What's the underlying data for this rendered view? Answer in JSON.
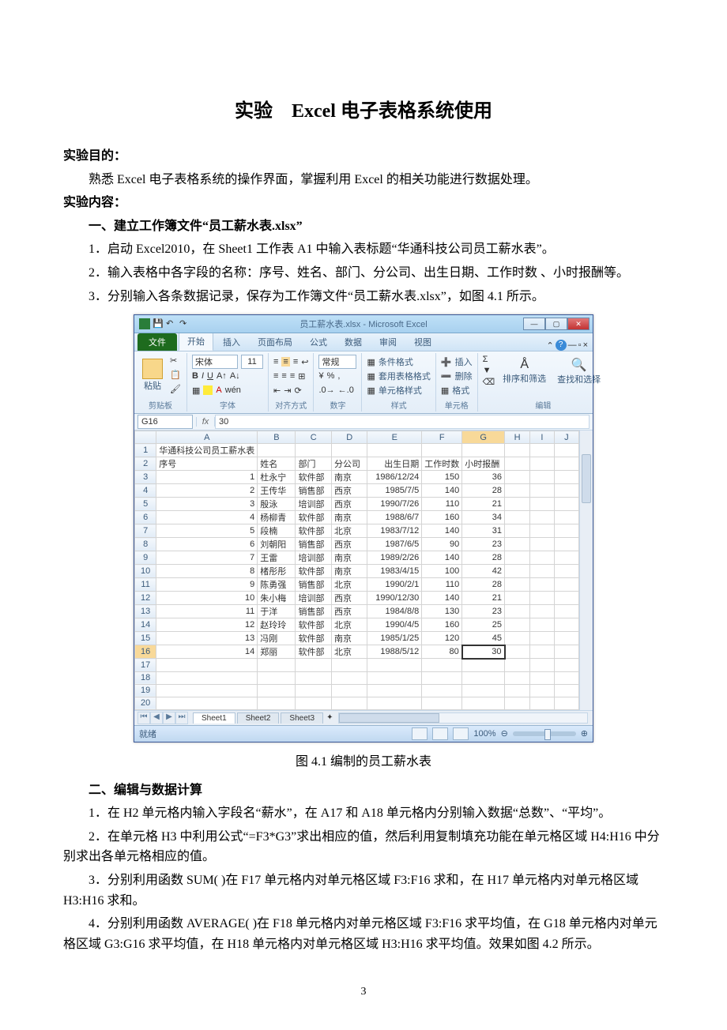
{
  "doc": {
    "title": "实验　Excel 电子表格系统使用",
    "sec_purpose_head": "实验目的：",
    "sec_purpose_body": "熟悉 Excel 电子表格系统的操作界面，掌握利用 Excel 的相关功能进行数据处理。",
    "sec_content_head": "实验内容：",
    "sec1_head": "一、建立工作簿文件“员工薪水表.xlsx”",
    "sec1_p1": "1．启动 Excel2010，在 Sheet1 工作表 A1 中输入表标题“华通科技公司员工薪水表”。",
    "sec1_p2": "2．输入表格中各字段的名称：序号、姓名、部门、分公司、出生日期、工作时数 、小时报酬等。",
    "sec1_p3": "3．分别输入各条数据记录，保存为工作簿文件“员工薪水表.xlsx”，如图 4.1 所示。",
    "fig_caption": "图 4.1  编制的员工薪水表",
    "sec2_head": "二、编辑与数据计算",
    "sec2_p1": "1．在 H2 单元格内输入字段名“薪水”，在 A17 和 A18 单元格内分别输入数据“总数”、“平均”。",
    "sec2_p2": "2．在单元格 H3 中利用公式“=F3*G3”求出相应的值，然后利用复制填充功能在单元格区域 H4:H16 中分别求出各单元格相应的值。",
    "sec2_p3": "3．分别利用函数 SUM( )在 F17 单元格内对单元格区域 F3:F16 求和，在 H17 单元格内对单元格区域 H3:H16 求和。",
    "sec2_p4": "4．分别利用函数 AVERAGE( )在 F18 单元格内对单元格区域 F3:F16 求平均值，在 G18 单元格内对单元格区域 G3:G16 求平均值，在 H18 单元格内对单元格区域 H3:H16 求平均值。效果如图 4.2 所示。",
    "pagenum": "3"
  },
  "excel": {
    "titlebar": "员工薪水表.xlsx - Microsoft Excel",
    "tabs": {
      "file": "文件",
      "home": "开始",
      "insert": "插入",
      "layout": "页面布局",
      "formula": "公式",
      "data": "数据",
      "review": "审阅",
      "view": "视图"
    },
    "groups": {
      "clipboard": "剪贴板",
      "paste": "粘贴",
      "font": "字体",
      "align": "对齐方式",
      "number": "数字",
      "styles": "样式",
      "cells": "单元格",
      "editing": "编辑"
    },
    "font": {
      "name": "宋体",
      "size": "11"
    },
    "numfmt": "常规",
    "styles": {
      "cond": "条件格式",
      "tbl": "套用表格格式",
      "cell": "单元格样式"
    },
    "cells": {
      "insert": "插入",
      "delete": "删除",
      "format": "格式"
    },
    "editing": {
      "sort": "排序和筛选",
      "find": "查找和选择"
    },
    "namebox": "G16",
    "formula": "30",
    "cols": [
      "A",
      "B",
      "C",
      "D",
      "E",
      "F",
      "G",
      "H",
      "I",
      "J"
    ],
    "row1": "华通科技公司员工薪水表",
    "headers": {
      "A": "序号",
      "B": "姓名",
      "C": "部门",
      "D": "分公司",
      "E": "出生日期",
      "F": "工作时数",
      "G": "小时报酬"
    },
    "rows": [
      {
        "n": "3",
        "A": "1",
        "B": "杜永宁",
        "C": "软件部",
        "D": "南京",
        "E": "1986/12/24",
        "F": "150",
        "G": "36"
      },
      {
        "n": "4",
        "A": "2",
        "B": "王传华",
        "C": "销售部",
        "D": "西京",
        "E": "1985/7/5",
        "F": "140",
        "G": "28"
      },
      {
        "n": "5",
        "A": "3",
        "B": "殷泳",
        "C": "培训部",
        "D": "西京",
        "E": "1990/7/26",
        "F": "110",
        "G": "21"
      },
      {
        "n": "6",
        "A": "4",
        "B": "杨柳青",
        "C": "软件部",
        "D": "南京",
        "E": "1988/6/7",
        "F": "160",
        "G": "34"
      },
      {
        "n": "7",
        "A": "5",
        "B": "段楠",
        "C": "软件部",
        "D": "北京",
        "E": "1983/7/12",
        "F": "140",
        "G": "31"
      },
      {
        "n": "8",
        "A": "6",
        "B": "刘朝阳",
        "C": "销售部",
        "D": "西京",
        "E": "1987/6/5",
        "F": "90",
        "G": "23"
      },
      {
        "n": "9",
        "A": "7",
        "B": "王雷",
        "C": "培训部",
        "D": "南京",
        "E": "1989/2/26",
        "F": "140",
        "G": "28"
      },
      {
        "n": "10",
        "A": "8",
        "B": "楮彤彤",
        "C": "软件部",
        "D": "南京",
        "E": "1983/4/15",
        "F": "100",
        "G": "42"
      },
      {
        "n": "11",
        "A": "9",
        "B": "陈勇强",
        "C": "销售部",
        "D": "北京",
        "E": "1990/2/1",
        "F": "110",
        "G": "28"
      },
      {
        "n": "12",
        "A": "10",
        "B": "朱小梅",
        "C": "培训部",
        "D": "西京",
        "E": "1990/12/30",
        "F": "140",
        "G": "21"
      },
      {
        "n": "13",
        "A": "11",
        "B": "于洋",
        "C": "销售部",
        "D": "西京",
        "E": "1984/8/8",
        "F": "130",
        "G": "23"
      },
      {
        "n": "14",
        "A": "12",
        "B": "赵玲玲",
        "C": "软件部",
        "D": "北京",
        "E": "1990/4/5",
        "F": "160",
        "G": "25"
      },
      {
        "n": "15",
        "A": "13",
        "B": "冯刚",
        "C": "软件部",
        "D": "南京",
        "E": "1985/1/25",
        "F": "120",
        "G": "45"
      },
      {
        "n": "16",
        "A": "14",
        "B": "郑丽",
        "C": "软件部",
        "D": "北京",
        "E": "1988/5/12",
        "F": "80",
        "G": "30"
      }
    ],
    "emptyrows": [
      "17",
      "18",
      "19",
      "20"
    ],
    "sheets": [
      "Sheet1",
      "Sheet2",
      "Sheet3"
    ],
    "status": "就绪",
    "zoom": "100%"
  }
}
